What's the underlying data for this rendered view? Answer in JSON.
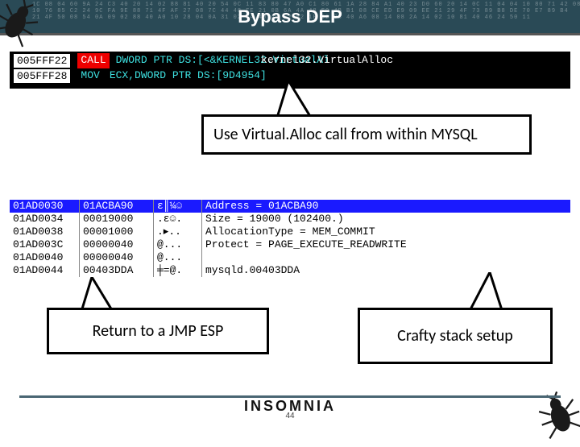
{
  "header": {
    "title": "Bypass DEP",
    "hex_bg": "1C 08 04 60 9A 24 C3 40 20 14 02 88 81 40 20 54 0C 11 83 80 47 A0 C1 80 61 1A 28 84 A1 40 23 D0 60 20 14 0C 11 04 04 10 80 71 42 08 7E FE\n10 76 85 C2 24 9C FA 9E 88 71 4F AF 27 08 7C 44 48 EE 21 0B 6A 4A 48 E0 4B B1 08 CE ED E9 09 EE 21 29 4F 73 89 B8 DE 70 E7 89 B4\n21 4F 50 08 54 0A 09 02 88 40 A0 10 28 04 0A 31 02 84 40 A0 E2 82 1B 02 88 40 A6 08 14 08 2A 14 02 10 81 40 46 24 50 11"
  },
  "dbg1": {
    "rows": [
      {
        "addr": "005FFF22",
        "op": "CALL",
        "rest": "DWORD PTR DS:[<&KERNEL32.VirtualAl",
        "annot": "kernel32.VirtualAlloc"
      },
      {
        "addr": "005FFF28",
        "op": "MOV",
        "rest": "ECX,DWORD PTR DS:[9D4954]"
      }
    ]
  },
  "callouts": {
    "c1": "Use Virtual.Alloc call from within MYSQL",
    "c2": "Return to a JMP ESP",
    "c3": "Crafty stack setup"
  },
  "dbg2": {
    "rows": [
      {
        "addr": "01AD0030",
        "val": "01ACBA90",
        "ascii": "ε║¼☺",
        "annot": "Address = 01ACBA90",
        "hl": true
      },
      {
        "addr": "01AD0034",
        "val": "00019000",
        "ascii": ".ε☺.",
        "annot": "Size = 19000 (102400.)"
      },
      {
        "addr": "01AD0038",
        "val": "00001000",
        "ascii": ".▸..",
        "annot": "AllocationType = MEM_COMMIT"
      },
      {
        "addr": "01AD003C",
        "val": "00000040",
        "ascii": "@...",
        "annot": "Protect = PAGE_EXECUTE_READWRITE"
      },
      {
        "addr": "01AD0040",
        "val": "00000040",
        "ascii": "@...",
        "annot": ""
      },
      {
        "addr": "01AD0044",
        "val": "00403DDA",
        "ascii": "╪=@.",
        "annot": "mysqld.00403DDA"
      }
    ]
  },
  "footer": {
    "brand": "INSOMNIA",
    "page": "44"
  }
}
